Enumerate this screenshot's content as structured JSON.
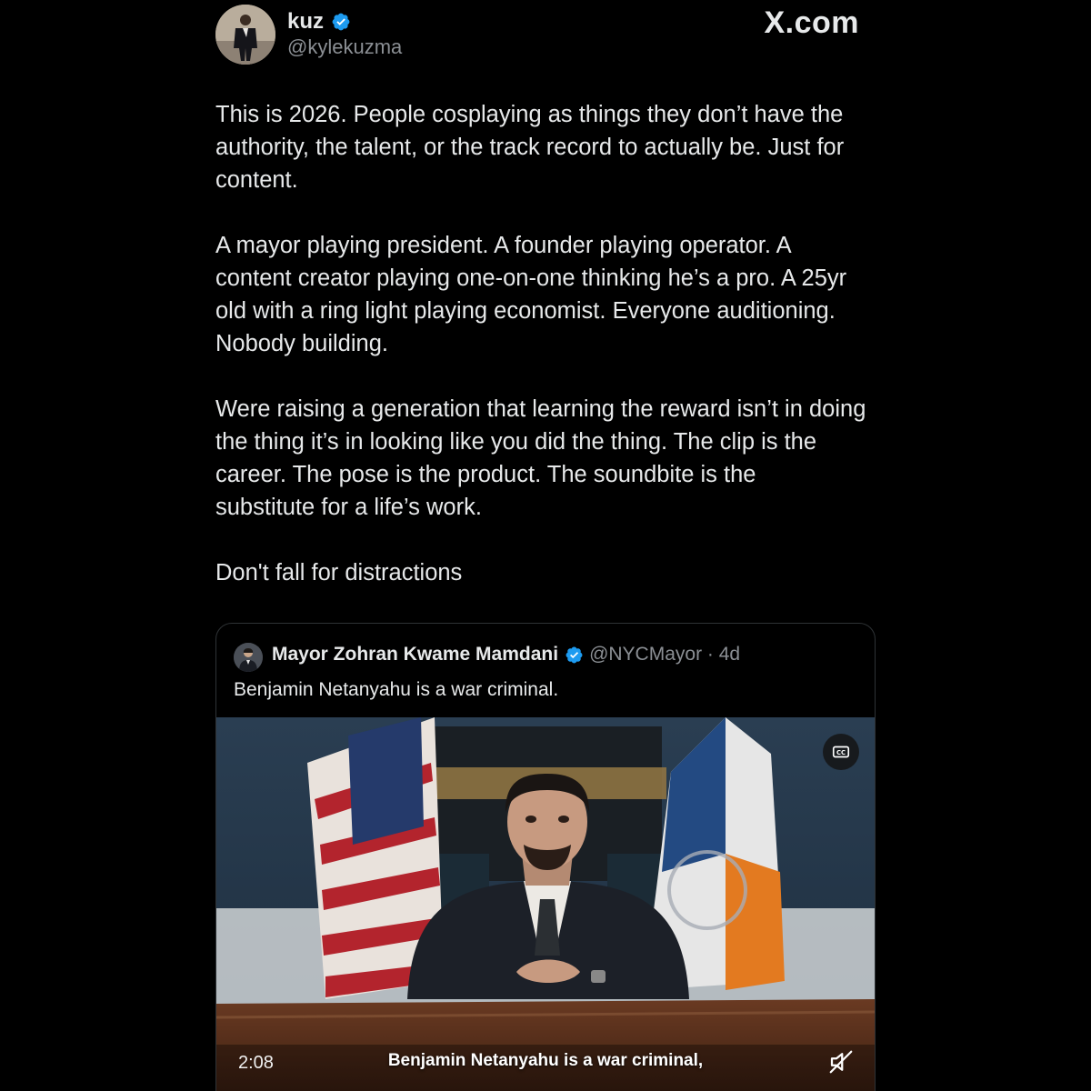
{
  "header": {
    "display_name": "kuz",
    "handle": "@kylekuzma",
    "brand": "X.com",
    "icons": {
      "avatar": "profile-photo",
      "verified": "verified-badge-icon"
    },
    "accent_color": "#1d9bf0"
  },
  "post": {
    "paragraphs": [
      "This is 2026. People cosplaying as things they don’t have the\nauthority, the talent, or the track record to actually be. Just for\ncontent.",
      "A mayor playing president. A founder playing operator. A\ncontent creator playing one-on-one thinking he’s a pro. A 25yr\nold with a ring light playing economist. Everyone auditioning.\nNobody building.",
      "Were raising a generation that learning the reward isn’t in doing\nthe thing it’s in looking like you did the thing. The clip is the\ncareer. The pose is the product. The soundbite is the\nsubstitute for a life’s work.",
      "Don't fall for distractions"
    ]
  },
  "quote": {
    "display_name": "Mayor Zohran Kwame Mamdani",
    "handle_time": "@NYCMayor · 4d",
    "text": "Benjamin Netanyahu is a war criminal.",
    "video": {
      "duration": "2:08",
      "caption": "Benjamin Netanyahu is a war criminal,",
      "icons": {
        "captions": "closed-captions-icon",
        "mute": "speaker-muted-icon"
      }
    }
  }
}
